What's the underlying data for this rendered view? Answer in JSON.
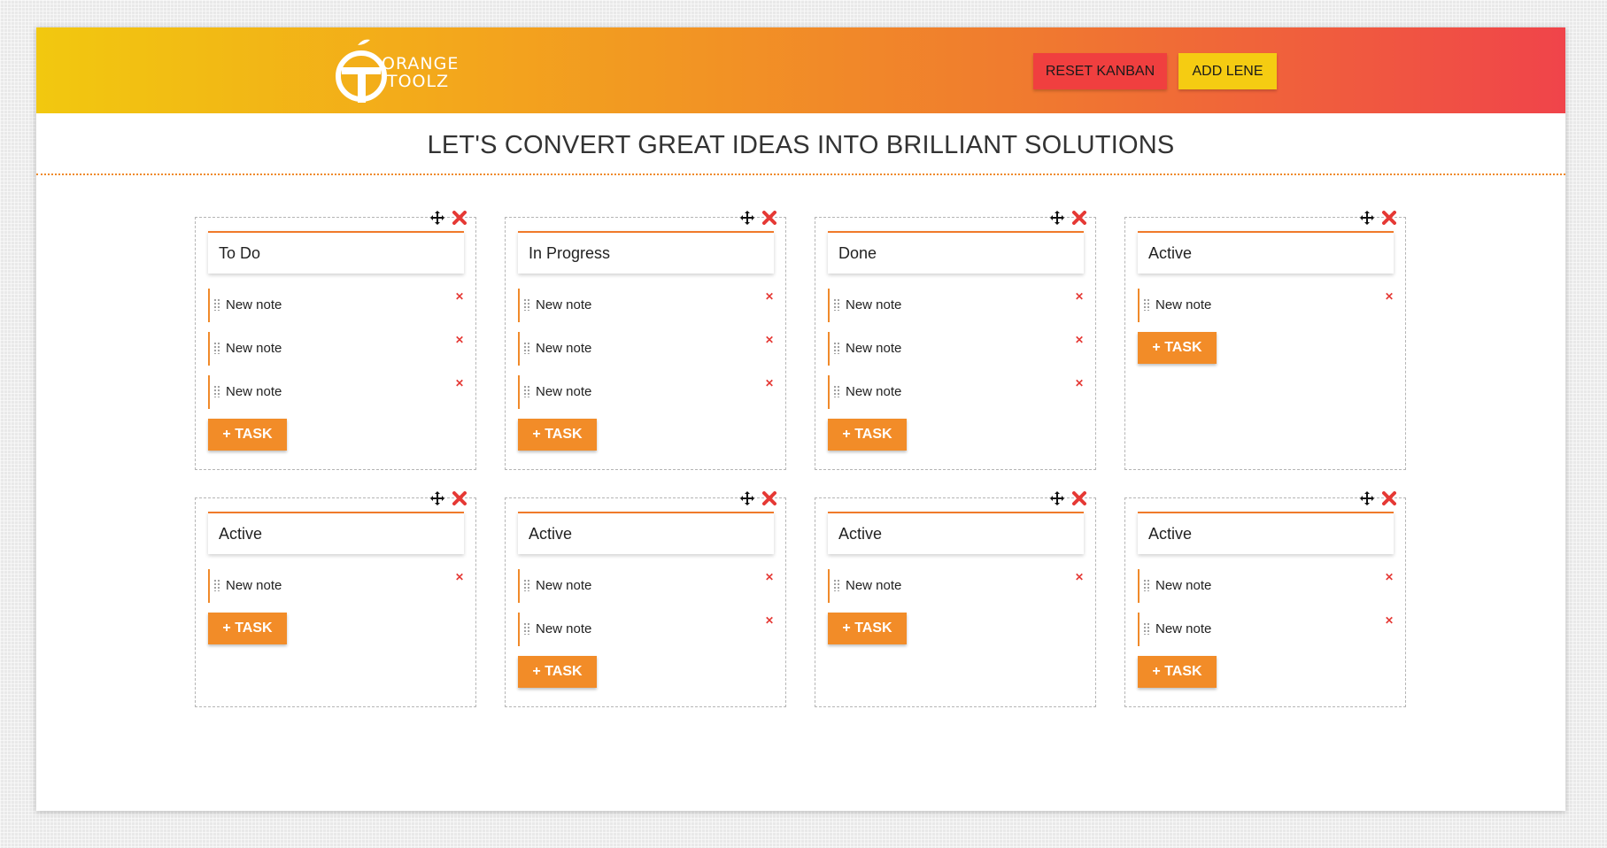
{
  "header": {
    "logo_line1": "ORANGE",
    "logo_line2": "TOOLZ",
    "reset_label": "RESET KANBAN",
    "add_label": "ADD LENE"
  },
  "tagline": "LET'S CONVERT GREAT IDEAS INTO BRILLIANT SOLUTIONS",
  "icons": {
    "move": "move-arrows-icon",
    "delete": "close-x-icon"
  },
  "colors": {
    "accent": "#f28c28",
    "delete": "#e53935",
    "reset": "#f03f3f",
    "add": "#f5cc12"
  },
  "lanes": [
    {
      "title": "To Do",
      "notes": [
        "New note",
        "New note",
        "New note"
      ],
      "button": "+ TASK"
    },
    {
      "title": "In Progress",
      "notes": [
        "New note",
        "New note",
        "New note"
      ],
      "button": "+ TASK"
    },
    {
      "title": "Done",
      "notes": [
        "New note",
        "New note",
        "New note"
      ],
      "button": "+ TASK"
    },
    {
      "title": "Active",
      "notes": [
        "New note"
      ],
      "button": "+ TASK"
    },
    {
      "title": "Active",
      "notes": [
        "New note"
      ],
      "button": "+ TASK"
    },
    {
      "title": "Active",
      "notes": [
        "New note",
        "New note"
      ],
      "button": "+ TASK"
    },
    {
      "title": "Active",
      "notes": [
        "New note"
      ],
      "button": "+ TASK"
    },
    {
      "title": "Active",
      "notes": [
        "New note",
        "New note"
      ],
      "button": "+ TASK"
    }
  ]
}
